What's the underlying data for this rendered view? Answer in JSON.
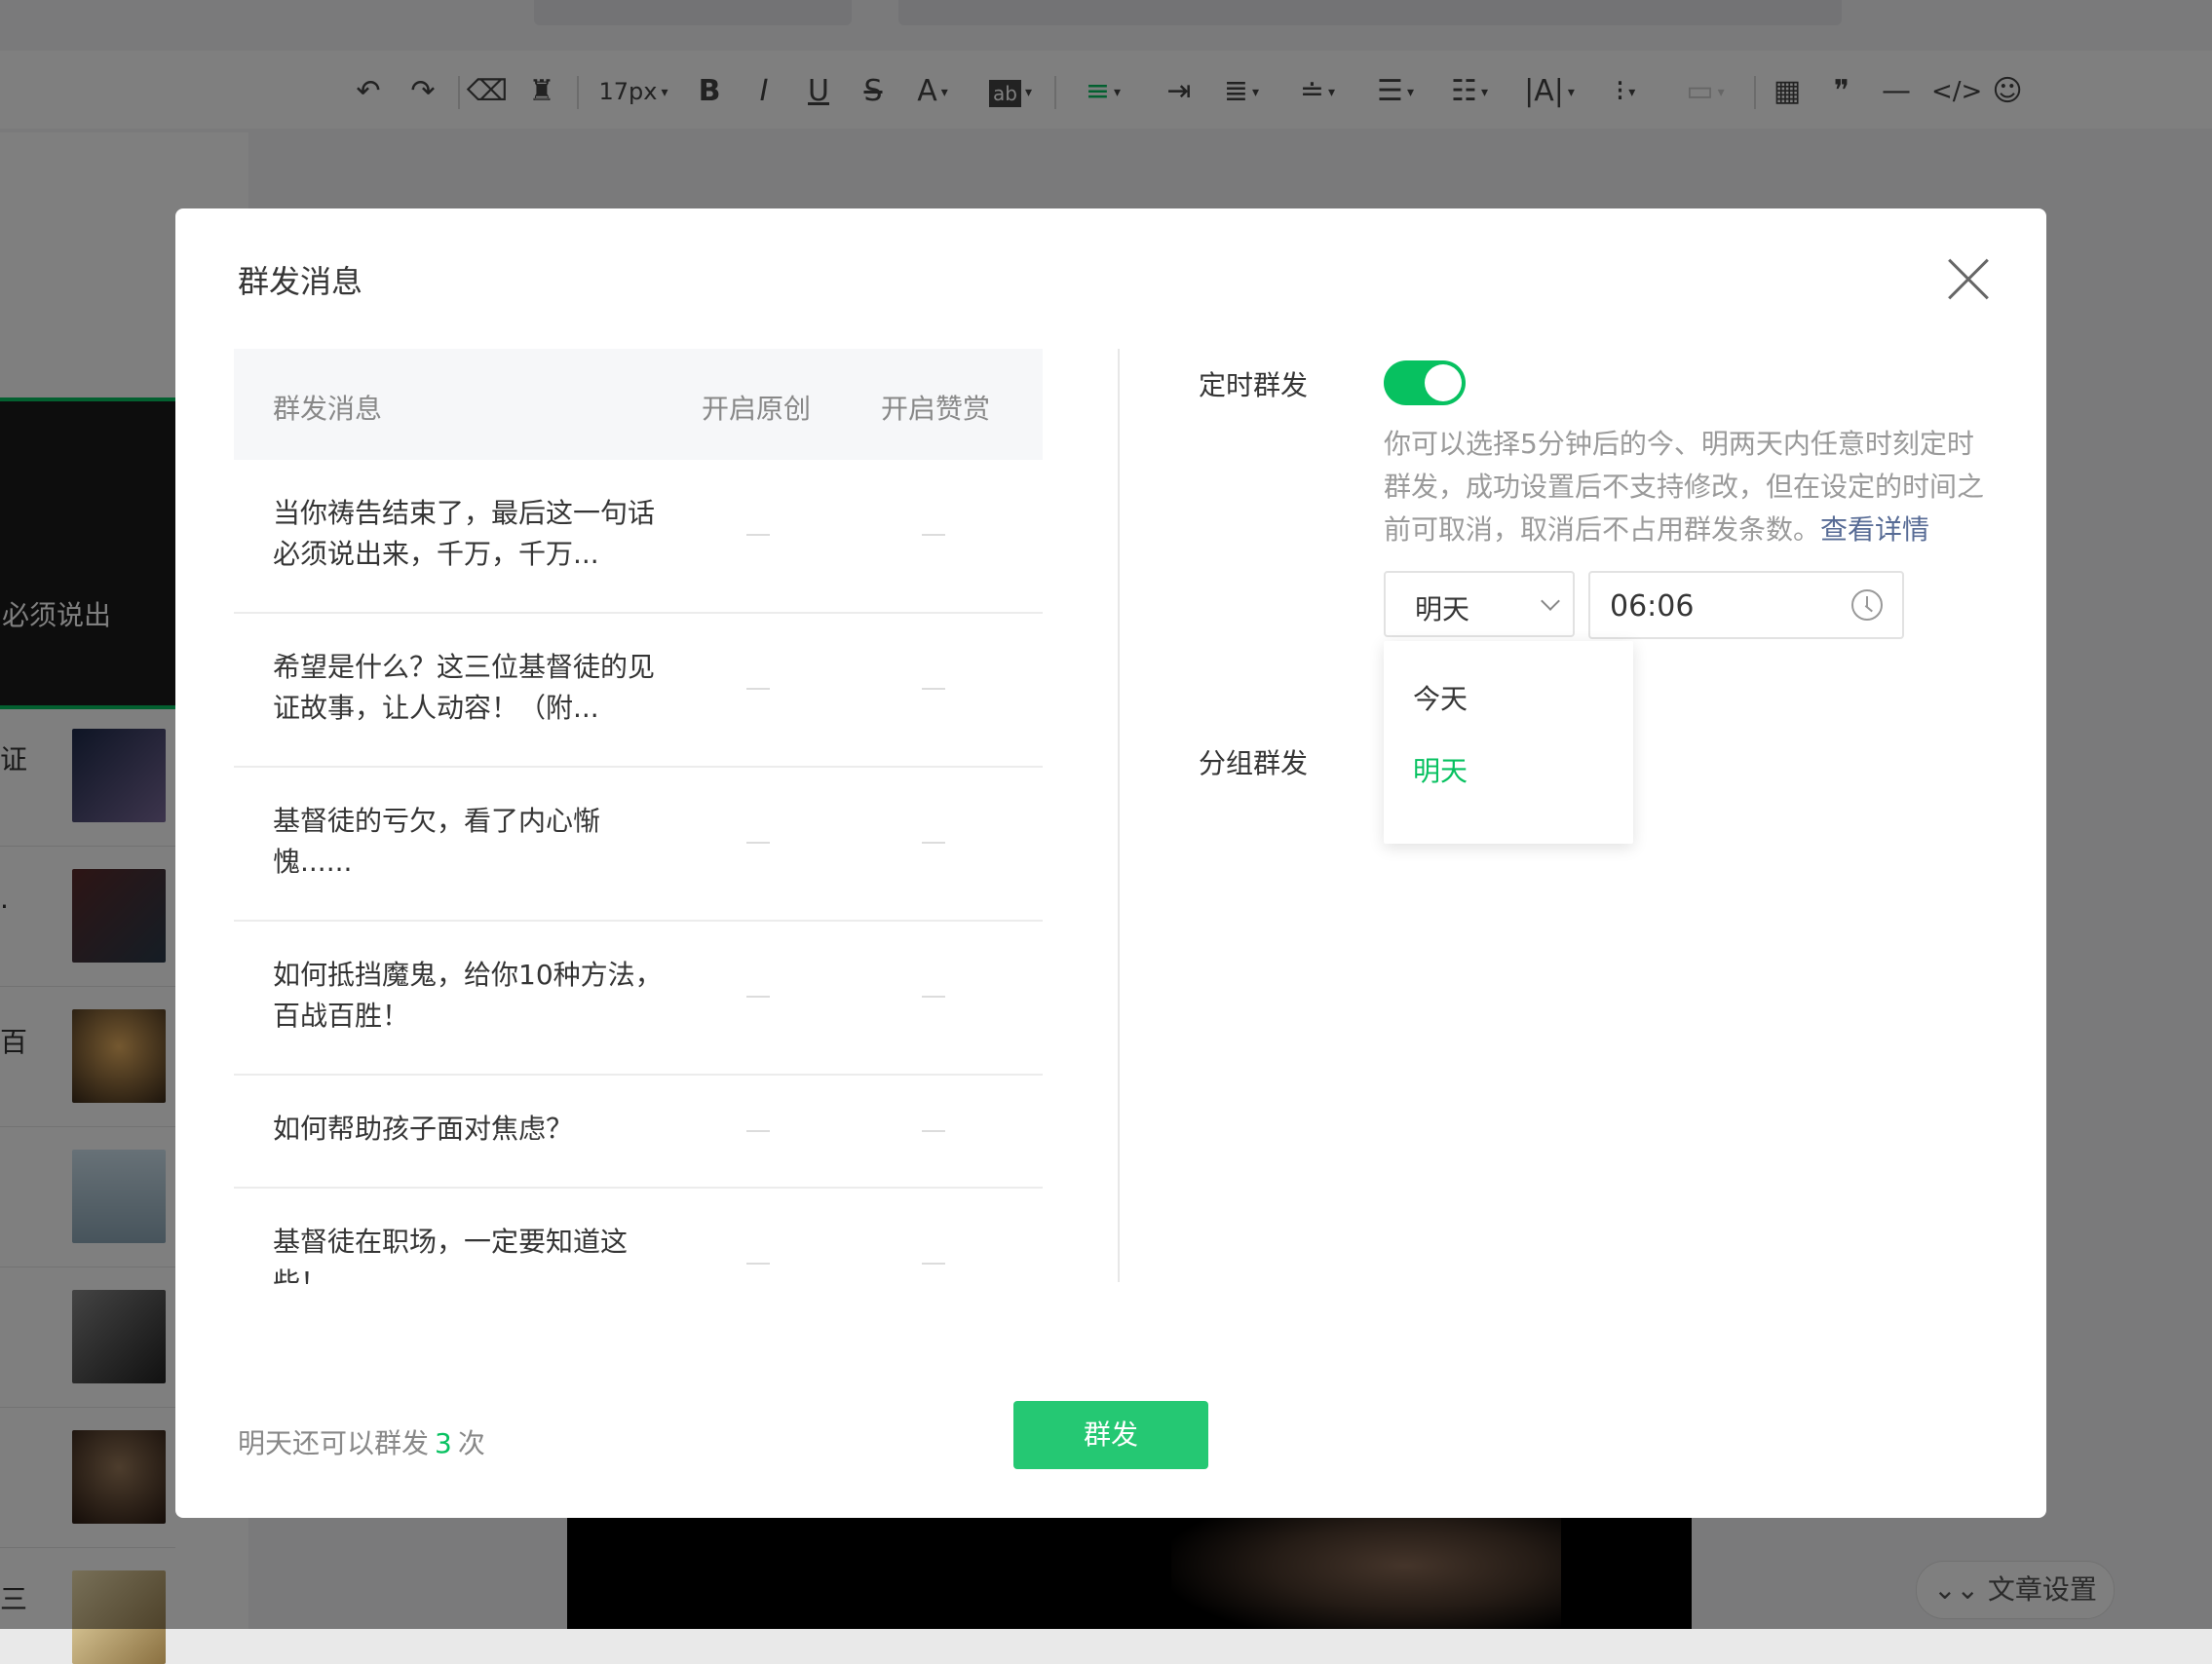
{
  "toolbar": {
    "font_size": "17px"
  },
  "background": {
    "left_feature_text": "必须说出",
    "left_chars": [
      "证",
      ".",
      "百",
      "三"
    ],
    "article_settings_label": "文章设置"
  },
  "modal": {
    "title": "群发消息",
    "table": {
      "headers": [
        "群发消息",
        "开启原创",
        "开启赞赏"
      ],
      "rows": [
        {
          "title": "当你祷告结束了，最后这一句话必须说出来，千万，千万...",
          "original": "—",
          "reward": "—"
        },
        {
          "title": "希望是什么？这三位基督徒的见证故事，让人动容！（附...",
          "original": "—",
          "reward": "—"
        },
        {
          "title": "基督徒的亏欠，看了内心惭愧......",
          "original": "—",
          "reward": "—"
        },
        {
          "title": "如何抵挡魔鬼，给你10种方法，百战百胜！",
          "original": "—",
          "reward": "—"
        },
        {
          "title": "如何帮助孩子面对焦虑？",
          "original": "—",
          "reward": "—"
        },
        {
          "title": "基督徒在职场，一定要知道这些！",
          "original": "—",
          "reward": "—"
        }
      ]
    },
    "schedule": {
      "label": "定时群发",
      "enabled": true,
      "description": "你可以选择5分钟后的今、明两天内任意时刻定时群发，成功设置后不支持修改，但在设定的时间之前可取消，取消后不占用群发条数。",
      "detail_link": "查看详情",
      "day_value": "明天",
      "time_value": "06:06",
      "day_options": [
        "今天",
        "明天"
      ],
      "selected_option": "明天"
    },
    "group_label": "分组群发",
    "footer": {
      "prefix": "明天还可以群发",
      "count": "3",
      "suffix": "次"
    },
    "send_label": "群发"
  },
  "colors": {
    "accent": "#07c160",
    "link": "#576b95"
  }
}
